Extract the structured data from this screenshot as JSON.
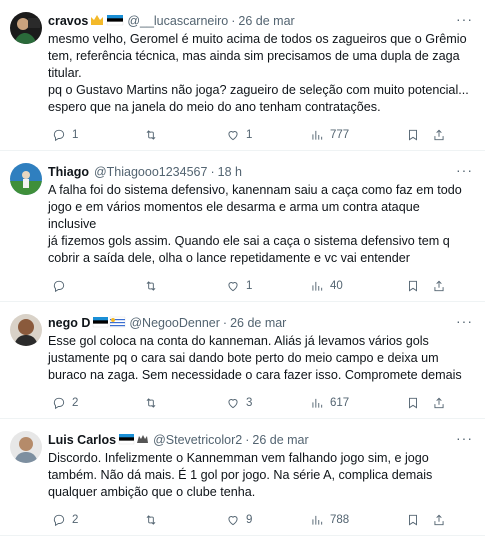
{
  "tweets": [
    {
      "name": "cravos",
      "handle": "@__lucascarneiro",
      "time": "26 de mar",
      "lines": [
        "mesmo velho, Geromel é muito acima de todos os zagueiros que o Grêmio",
        "tem, referência técnica, mas ainda sim precisamos de uma dupla de zaga",
        "titular.",
        "pq o Gustavo Martins não joga? zagueiro de seleção com muito potencial...",
        "espero que na janela do meio do ano tenham contratações."
      ],
      "replies": "1",
      "retweets": "",
      "likes": "1",
      "views": "777"
    },
    {
      "name": "Thiago",
      "handle": "@Thiagooo1234567",
      "time": "18 h",
      "lines": [
        "A falha foi do sistema defensivo, kanennam saiu a caça como faz em todo",
        "jogo e em vários momentos ele desarma e arma um contra ataque inclusive",
        "já fizemos gols assim. Quando ele sai a caça o sistema defensivo tem q",
        "cobrir a saída dele, olha o lance repetidamente e vc vai entender"
      ],
      "replies": "",
      "retweets": "",
      "likes": "1",
      "views": "40"
    },
    {
      "name": "nego D",
      "handle": "@NegooDenner",
      "time": "26 de mar",
      "lines": [
        "Esse gol coloca na conta do kanneman. Aliás já levamos vários gols",
        "justamente pq o cara sai dando bote perto do meio campo e deixa um",
        "buraco na zaga. Sem necessidade o cara fazer isso. Compromete demais"
      ],
      "replies": "2",
      "retweets": "",
      "likes": "3",
      "views": "617"
    },
    {
      "name": "Luis Carlos",
      "handle": "@Stevetricolor2",
      "time": "26 de mar",
      "lines": [
        "Discordo. Infelizmente o Kannemman vem falhando jogo sim, e jogo",
        "também. Não dá mais. É 1 gol por jogo. Na série A, complica demais",
        "qualquer ambição que o clube tenha."
      ],
      "replies": "2",
      "retweets": "",
      "likes": "9",
      "views": "788"
    }
  ],
  "more_label": "···",
  "dot": "·",
  "icons": [
    "reply-icon",
    "retweet-icon",
    "like-icon",
    "views-icon",
    "bookmark-icon",
    "share-icon"
  ],
  "colors": {
    "text": "#0f1419",
    "muted": "#536471",
    "border": "#eff3f4"
  }
}
